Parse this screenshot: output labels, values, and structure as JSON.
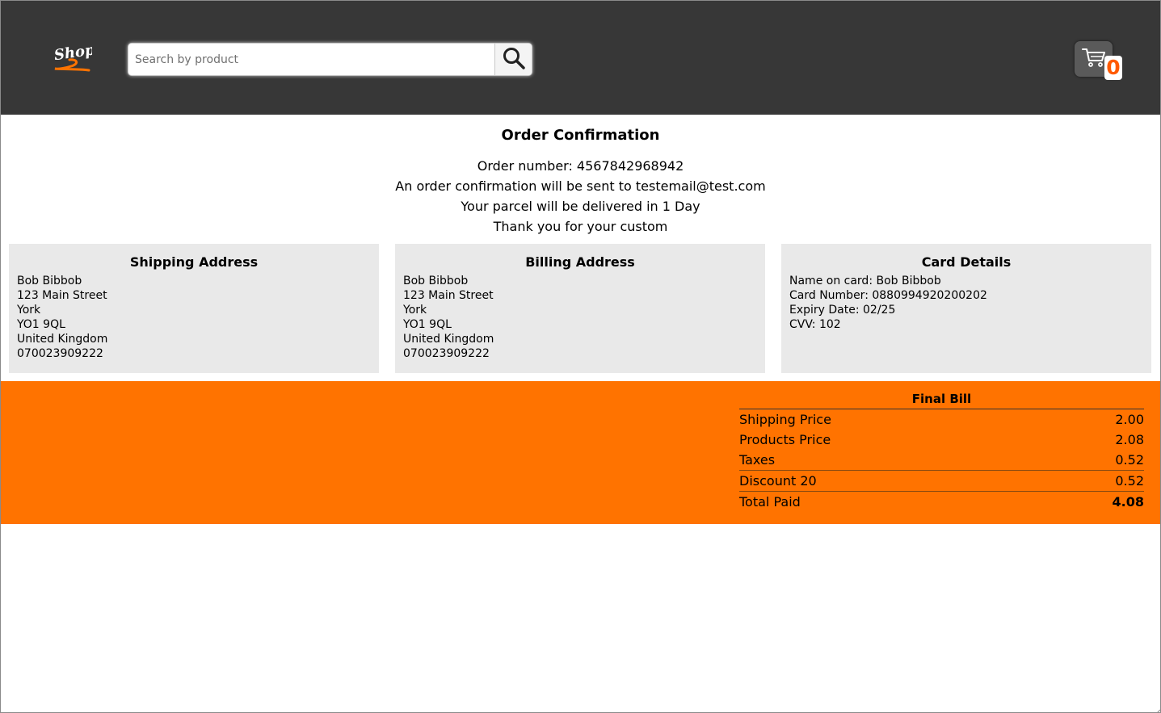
{
  "header": {
    "logo_text": "Shop",
    "search": {
      "placeholder": "Search by product",
      "icon": "search-icon"
    },
    "cart": {
      "icon": "cart-icon",
      "count": "0"
    }
  },
  "confirmation": {
    "title": "Order Confirmation",
    "order_number": "Order number: 4567842968942",
    "email_line": "An order confirmation will be sent to testemail@test.com",
    "delivery_line": "Your parcel will be delivered in 1 Day",
    "thanks_line": "Thank you for your custom"
  },
  "shipping": {
    "title": "Shipping Address",
    "lines": [
      "Bob Bibbob",
      "123 Main Street",
      "York",
      "YO1 9QL",
      "United Kingdom",
      "070023909222"
    ]
  },
  "billing": {
    "title": "Billing Address",
    "lines": [
      "Bob Bibbob",
      "123 Main Street",
      "York",
      "YO1 9QL",
      "United Kingdom",
      "070023909222"
    ]
  },
  "card": {
    "title": "Card Details",
    "lines": [
      "Name on card: Bob Bibbob",
      "Card Number: 0880994920200202",
      "Expiry Date: 02/25",
      "CVV: 102"
    ]
  },
  "bill": {
    "title": "Final Bill",
    "rows": [
      {
        "label": "Shipping Price",
        "value": "2.00"
      },
      {
        "label": "Products Price",
        "value": "2.08"
      },
      {
        "label": "Taxes",
        "value": "0.52"
      },
      {
        "label": "Discount 20",
        "value": "0.52"
      },
      {
        "label": "Total Paid",
        "value": "4.08"
      }
    ]
  },
  "colors": {
    "header_bg": "#373737",
    "accent": "#ff7300",
    "cart_badge_text": "#ff5a00",
    "panel_bg": "#e9e9e9"
  }
}
